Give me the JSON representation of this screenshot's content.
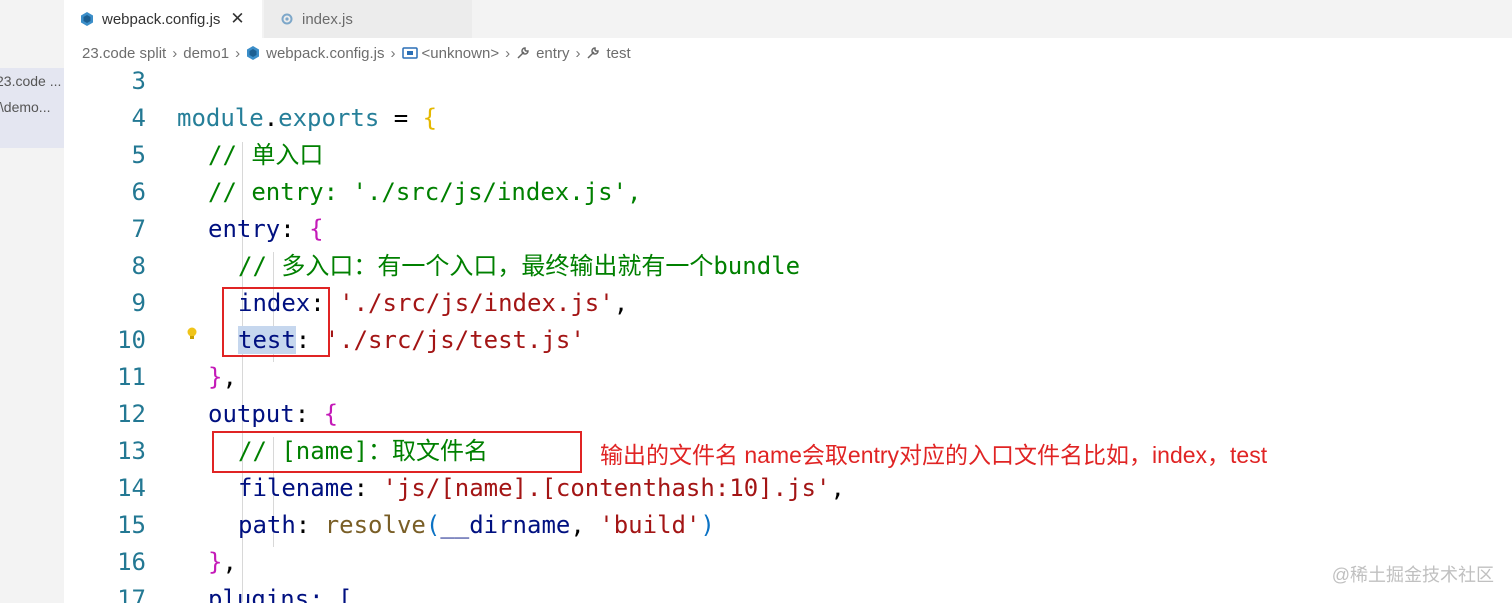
{
  "sidebar": {
    "rows": [
      "23.code ...",
      "t\\demo...",
      ""
    ]
  },
  "tabs": [
    {
      "label": "webpack.config.js",
      "active": true,
      "close": "✕"
    },
    {
      "label": "index.js",
      "active": false
    }
  ],
  "breadcrumb": [
    "23.code split",
    "demo1",
    "webpack.config.js",
    "<unknown>",
    "entry",
    "test"
  ],
  "editor": {
    "lines": [
      {
        "n": "3"
      },
      {
        "n": "4"
      },
      {
        "n": "5"
      },
      {
        "n": "6"
      },
      {
        "n": "7"
      },
      {
        "n": "8"
      },
      {
        "n": "9"
      },
      {
        "n": "10"
      },
      {
        "n": "11"
      },
      {
        "n": "12"
      },
      {
        "n": "13"
      },
      {
        "n": "14"
      },
      {
        "n": "15"
      },
      {
        "n": "16"
      },
      {
        "n": "17"
      }
    ],
    "t": {
      "module": "module",
      "exports": "exports",
      "c5": "// 单入口",
      "c6": "// entry: './src/js/index.js',",
      "entry": "entry",
      "c8": "// 多入口：有一个入口，最终输出就有一个bundle",
      "index": "index",
      "s9": "'./src/js/index.js'",
      "test": "test",
      "s10": "'./src/js/test.js'",
      "output": "output",
      "c13": "// [name]：取文件名",
      "filename": "filename",
      "s14": "'js/[name].[contenthash:10].js'",
      "path": "path",
      "resolve": "resolve",
      "dirname": "__dirname",
      "s15": "'build'",
      "l17": "plugins: ["
    }
  },
  "annotation": "输出的文件名 name会取entry对应的入口文件名比如，index，test",
  "watermark": "@稀土掘金技术社区",
  "colors": {
    "annotation": "#e02424",
    "line_number": "#237893",
    "comment": "#008000",
    "string": "#a31515"
  }
}
